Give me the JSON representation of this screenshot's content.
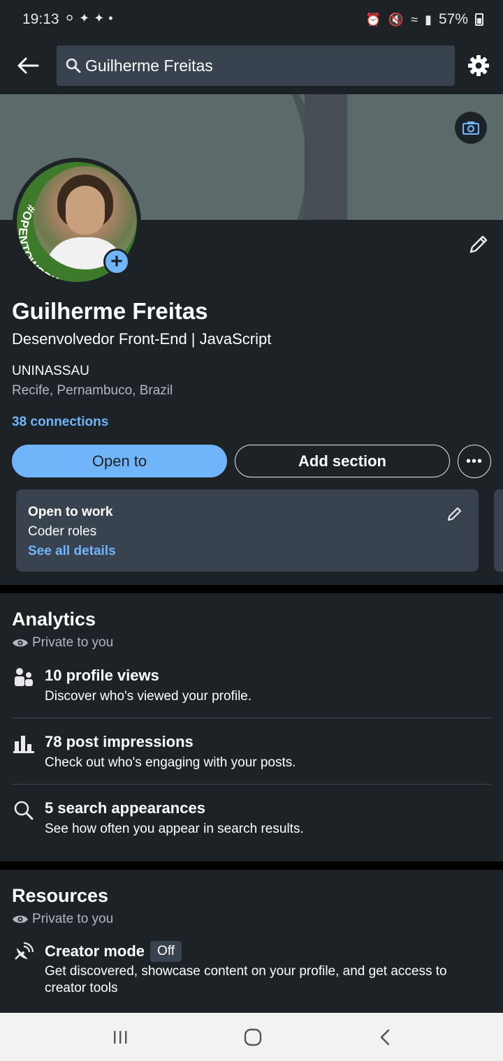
{
  "status_bar": {
    "time": "19:13",
    "battery": "57%"
  },
  "search": {
    "value": "Guilherme Freitas"
  },
  "profile": {
    "name": "Guilherme Freitas",
    "headline": "Desenvolvedor Front-End | JavaScript",
    "school": "UNINASSAU",
    "location": "Recife, Pernambuco, Brazil",
    "connections": "38 connections",
    "avatar_frame_text": "#OPENTOWORK"
  },
  "actions": {
    "open_to": "Open to",
    "add_section": "Add section"
  },
  "open_to_work": {
    "title": "Open to work",
    "roles": "Coder roles",
    "link": "See all details"
  },
  "analytics": {
    "title": "Analytics",
    "private": "Private to you",
    "items": [
      {
        "icon": "people-icon",
        "title": "10 profile views",
        "sub": "Discover who's viewed your profile."
      },
      {
        "icon": "bar-chart-icon",
        "title": "78 post impressions",
        "sub": "Check out who's engaging with your posts."
      },
      {
        "icon": "search-icon",
        "title": "5 search appearances",
        "sub": "See how often you appear in search results."
      }
    ]
  },
  "resources": {
    "title": "Resources",
    "private": "Private to you",
    "creator_mode": {
      "title": "Creator mode",
      "status": "Off",
      "sub": "Get discovered, showcase content on your profile, and get access to creator tools"
    }
  },
  "colors": {
    "background": "#1d2226",
    "card": "#38434f",
    "accent": "#70b5f9",
    "open_to_work_green": "#3d7a2a"
  }
}
